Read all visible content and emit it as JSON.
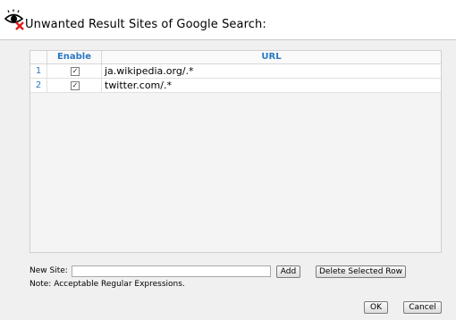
{
  "dialog": {
    "title": "Unwanted Result Sites of Google Search:",
    "logo_icon": "eye-with-red-x-icon"
  },
  "table": {
    "columns": [
      "",
      "Enable",
      "URL"
    ],
    "rows": [
      {
        "num": "1",
        "enabled": true,
        "url": "ja.wikipedia.org/.*"
      },
      {
        "num": "2",
        "enabled": true,
        "url": "twitter.com/.*"
      }
    ]
  },
  "form": {
    "new_site_label": "New Site:",
    "new_site_value": "",
    "add_label": "Add",
    "delete_label": "Delete Selected Row",
    "note": "Note: Acceptable Regular Expressions."
  },
  "footer": {
    "ok_label": "OK",
    "cancel_label": "Cancel"
  },
  "colors": {
    "header_text": "#2b78c2",
    "panel_bg": "#f0f0f0"
  }
}
